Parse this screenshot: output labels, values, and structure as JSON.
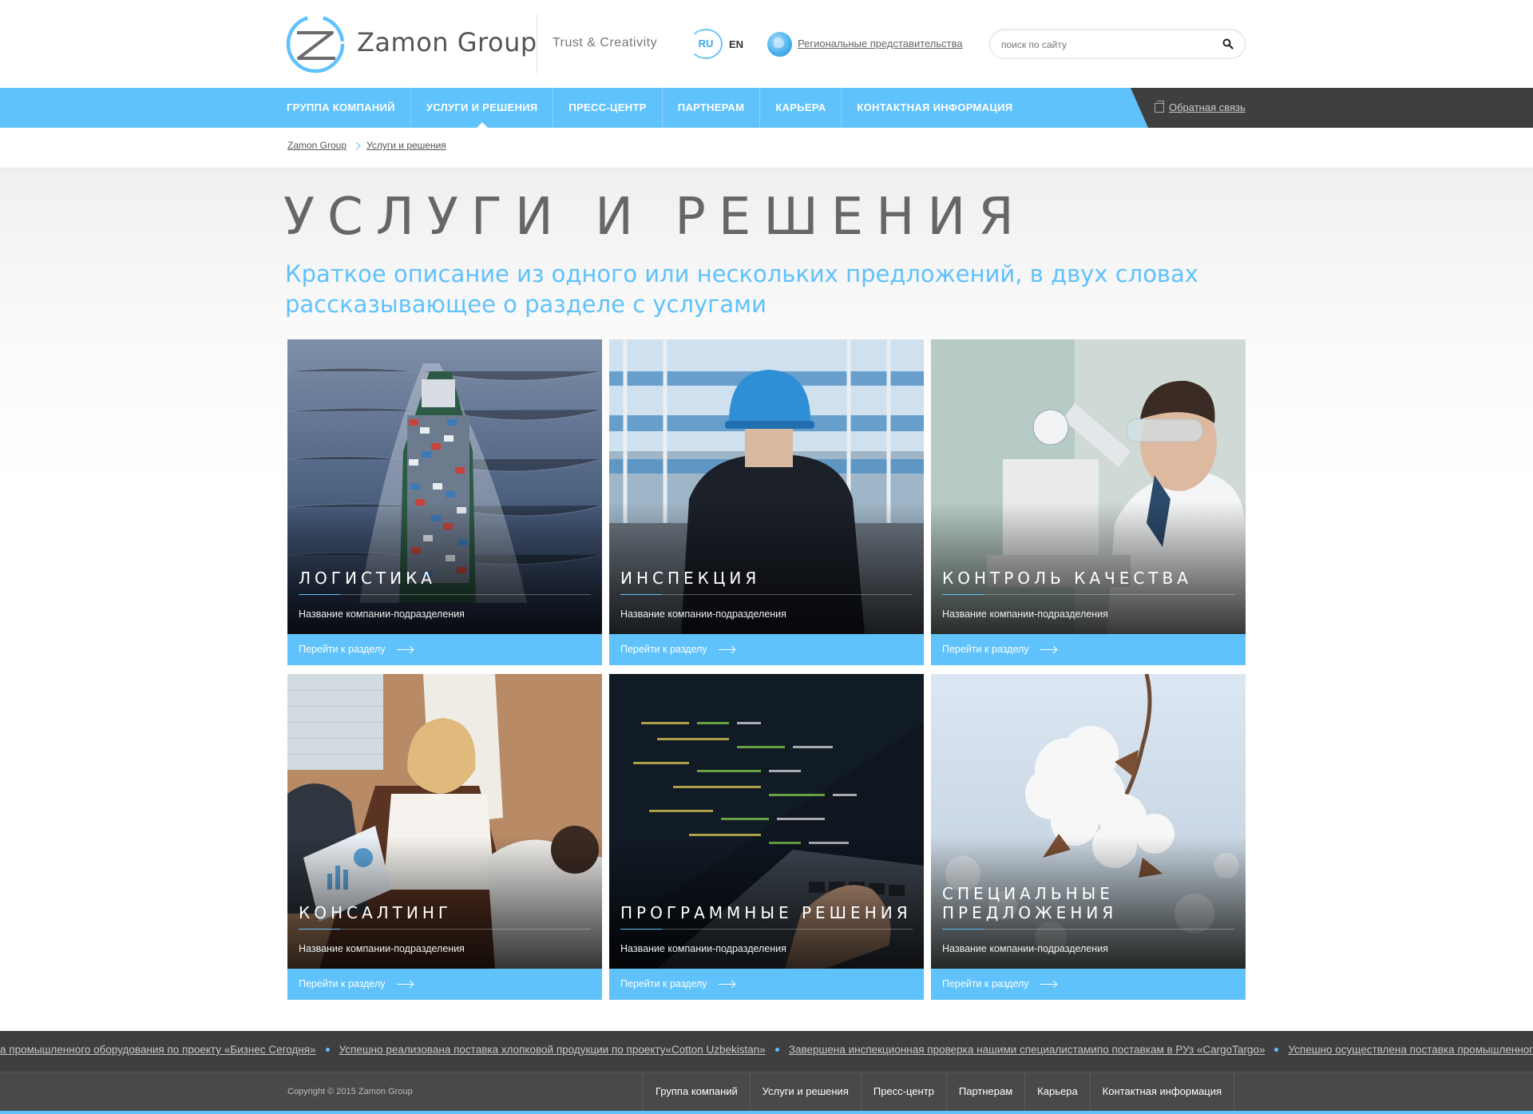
{
  "header": {
    "logo_text": "Zamon Group",
    "tagline": "Trust & Creativity",
    "lang_ru": "RU",
    "lang_en": "EN",
    "regional_link": "Региональные представительства",
    "search_placeholder": "поиск по сайту"
  },
  "nav": {
    "items": [
      {
        "label": "Группа компаний"
      },
      {
        "label": "Услуги и решения"
      },
      {
        "label": "Пресс-центр"
      },
      {
        "label": "Партнерам"
      },
      {
        "label": "Карьера"
      },
      {
        "label": "Контактная информация"
      }
    ],
    "feedback": "Обратная связь"
  },
  "breadcrumb": {
    "home": "Zamon Group",
    "current": "Услуги и решения"
  },
  "page": {
    "title": "Услуги и решения",
    "subtitle": "Краткое описание из одного или нескольких предложений, в двух словах рассказывающее о разделе с услугами"
  },
  "cards": [
    {
      "title": "Логистика",
      "subtitle": "Название компании-подразделения",
      "button": "Перейти к разделу"
    },
    {
      "title": "Инспекция",
      "subtitle": "Название компании-подразделения",
      "button": "Перейти к разделу"
    },
    {
      "title": "Контроль качества",
      "subtitle": "Название компании-подразделения",
      "button": "Перейти к разделу"
    },
    {
      "title": "Консалтинг",
      "subtitle": "Название компании-подразделения",
      "button": "Перейти к разделу"
    },
    {
      "title": "Программные решения",
      "subtitle": "Название компании-подразделения",
      "button": "Перейти к разделу"
    },
    {
      "title": "Специальные предложения",
      "subtitle": "Название компании-подразделения",
      "button": "Перейти к разделу"
    }
  ],
  "ticker": [
    "а промышленного оборудования по проекту «Бизнес Сегодня»",
    "Успешно реализована поставка хлопковой продукции по проекту«Cotton Uzbekistan»",
    "Завершена инспекционная проверка нашими специалистамипо поставкам в РУз «CargoTargo»",
    "Успешно осуществлена поставка промышленного оборудования"
  ],
  "footer": {
    "copyright": "Copyright © 2015 Zamon Group",
    "links": [
      "Группа компаний",
      "Услуги и решения",
      "Пресс-центр",
      "Партнерам",
      "Карьера",
      "Контактная информация"
    ]
  },
  "colors": {
    "accent": "#5fc2fb",
    "dark": "#3f3f3f",
    "footer": "#494949"
  }
}
